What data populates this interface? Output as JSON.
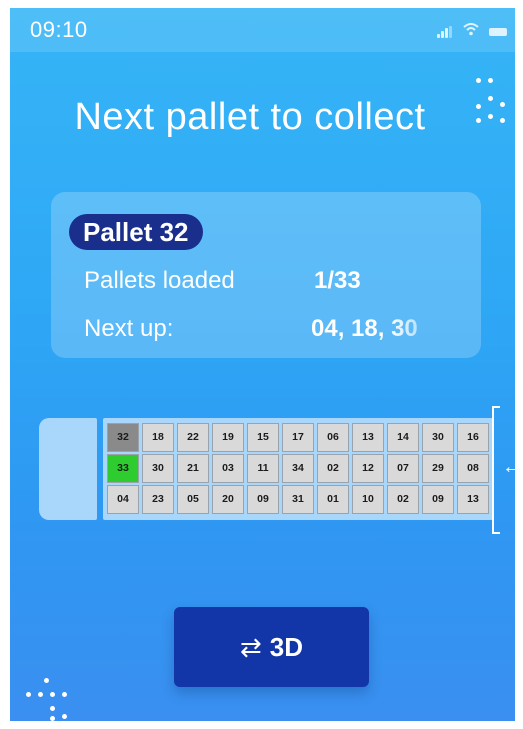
{
  "status_bar": {
    "time": "09:10",
    "icons": [
      "signal-icon",
      "wifi-icon",
      "battery-icon"
    ]
  },
  "headline": "Next pallet to collect",
  "card": {
    "pallet_label": "Pallet 32",
    "loaded_label": "Pallets loaded",
    "loaded_value": "1/33",
    "next_label": "Next up:",
    "next_value": "04, 18, 30"
  },
  "truck": {
    "rows": [
      [
        "32",
        "18",
        "22",
        "19",
        "15",
        "17",
        "06",
        "13",
        "14",
        "30",
        "16"
      ],
      [
        "33",
        "30",
        "21",
        "03",
        "11",
        "34",
        "02",
        "12",
        "07",
        "29",
        "08"
      ],
      [
        "04",
        "23",
        "05",
        "20",
        "09",
        "31",
        "01",
        "10",
        "02",
        "09",
        "13"
      ]
    ],
    "highlight_gray": "32",
    "highlight_green": "33",
    "colors": {
      "current": "#8a8a8a",
      "loaded": "#2ecc2e",
      "empty": "#d9d9d9"
    }
  },
  "button_3d": {
    "label": "3D",
    "icon": "swap-arrows-icon"
  },
  "colors": {
    "accent": "#1236a8",
    "pill": "#1a2f8c",
    "background": "#2ea6f5"
  }
}
